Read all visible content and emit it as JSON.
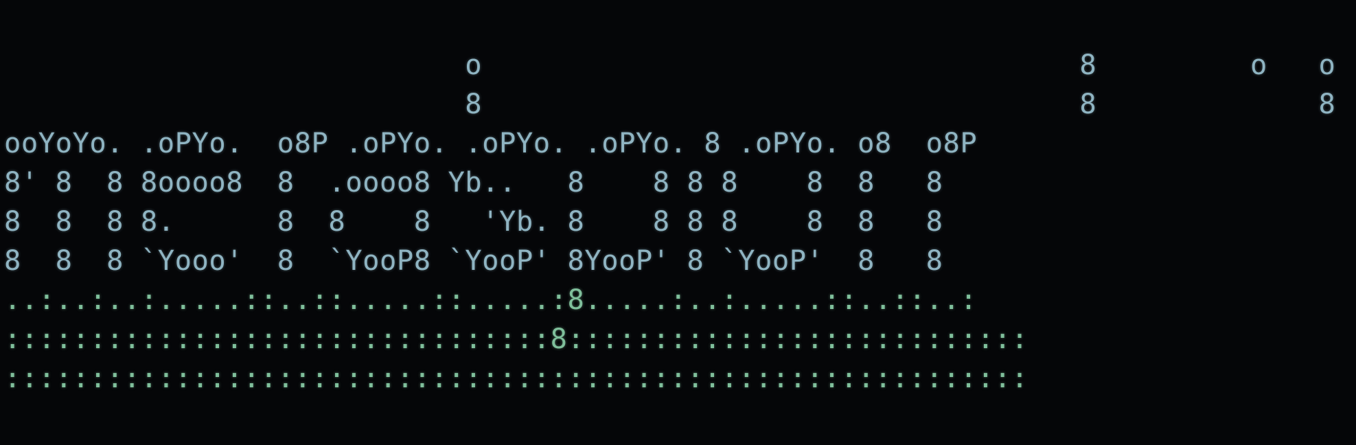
{
  "terminal": {
    "banner_lines": [
      "                           o                                   8         o   o",
      "                           8                                   8             8",
      "ooYoYo. .oPYo.  o8P .oPYo. .oPYo. .oPYo. 8 .oPYo. o8  o8P",
      "8' 8  8 8oooo8  8  .oooo8 Yb..   8    8 8 8    8  8   8",
      "8  8  8 8.      8  8    8   'Yb. 8    8 8 8    8  8   8",
      "8  8  8 `Yooo'  8  `YooP8 `YooP' 8YooP' 8 `YooP'  8   8",
      "..:..:..:.....::..::.....::.....:8.....:..:.....::..::..:",
      "::::::::::::::::::::::::::::::::8:::::::::::::::::::::::::::",
      "::::::::::::::::::::::::::::::::::::::::::::::::::::::::::::"
    ],
    "text_color": "#8fb4c2",
    "dots_color": "#7fbf9b",
    "background_color": "#050608"
  }
}
